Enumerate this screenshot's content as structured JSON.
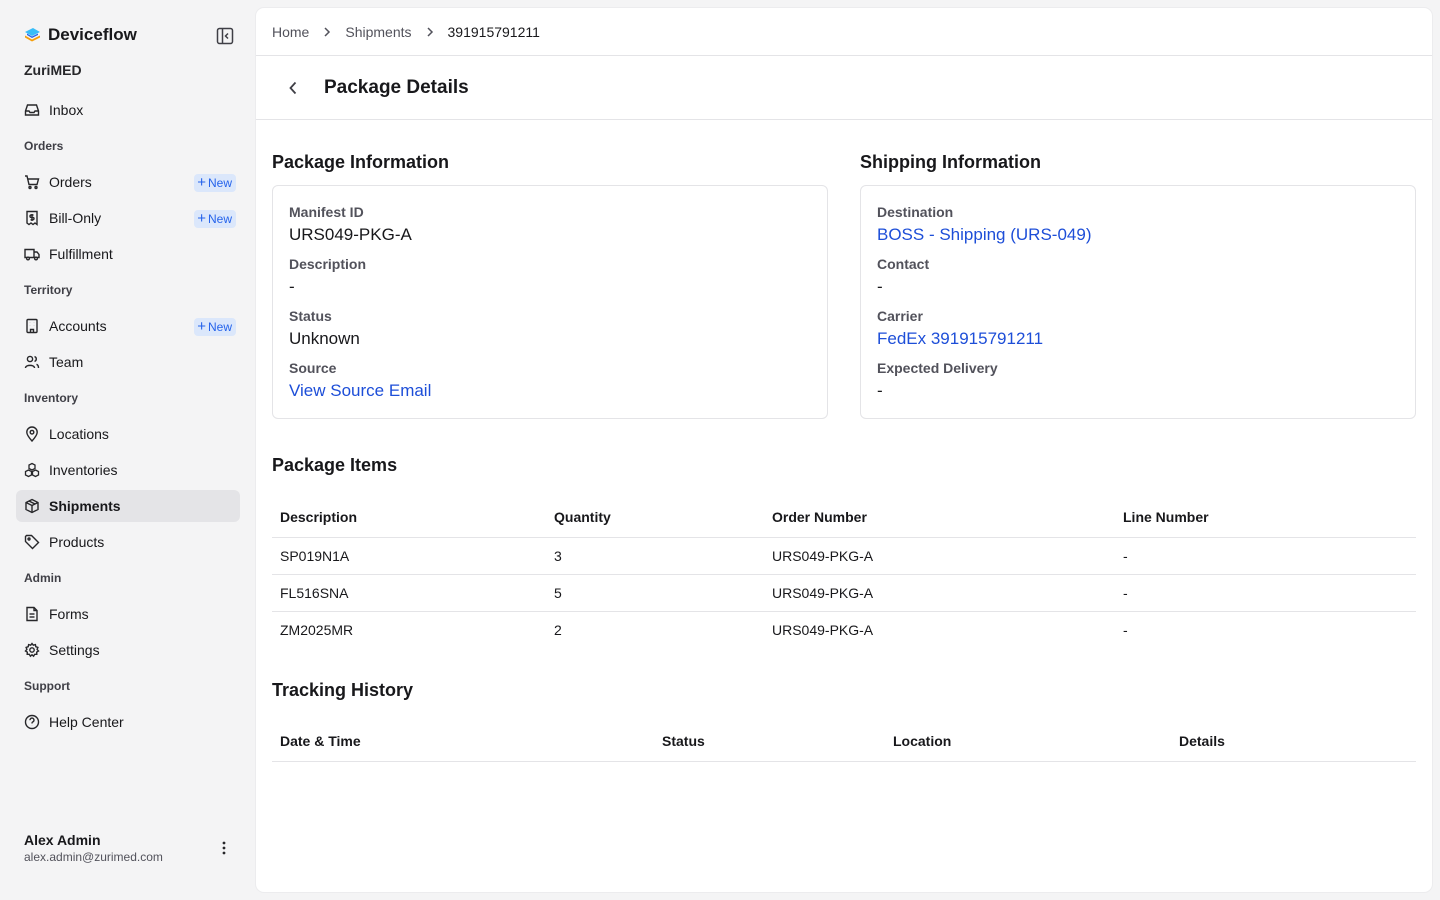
{
  "brand": {
    "name": "Deviceflow",
    "org": "ZuriMED"
  },
  "nav": {
    "inbox": "Inbox",
    "section_orders": "Orders",
    "orders": "Orders",
    "bill_only": "Bill-Only",
    "fulfillment": "Fulfillment",
    "section_territory": "Territory",
    "accounts": "Accounts",
    "team": "Team",
    "section_inventory": "Inventory",
    "locations": "Locations",
    "inventories": "Inventories",
    "shipments": "Shipments",
    "products": "Products",
    "section_admin": "Admin",
    "forms": "Forms",
    "settings": "Settings",
    "section_support": "Support",
    "help_center": "Help Center",
    "new_badge": "New"
  },
  "user": {
    "name": "Alex Admin",
    "email": "alex.admin@zurimed.com"
  },
  "breadcrumb": {
    "home": "Home",
    "shipments": "Shipments",
    "current": "391915791211"
  },
  "page": {
    "title": "Package Details"
  },
  "package_info": {
    "title": "Package Information",
    "manifest_label": "Manifest ID",
    "manifest_value": "URS049-PKG-A",
    "description_label": "Description",
    "description_value": "-",
    "status_label": "Status",
    "status_value": "Unknown",
    "source_label": "Source",
    "source_value": "View Source Email"
  },
  "shipping_info": {
    "title": "Shipping Information",
    "destination_label": "Destination",
    "destination_value": "BOSS - Shipping (URS-049)",
    "contact_label": "Contact",
    "contact_value": "-",
    "carrier_label": "Carrier",
    "carrier_value": "FedEx 391915791211",
    "delivery_label": "Expected Delivery",
    "delivery_value": "-"
  },
  "package_items": {
    "title": "Package Items",
    "columns": [
      "Description",
      "Quantity",
      "Order Number",
      "Line Number"
    ],
    "rows": [
      [
        "SP019N1A",
        "3",
        "URS049-PKG-A",
        "-"
      ],
      [
        "FL516SNA",
        "5",
        "URS049-PKG-A",
        "-"
      ],
      [
        "ZM2025MR",
        "2",
        "URS049-PKG-A",
        "-"
      ]
    ]
  },
  "tracking": {
    "title": "Tracking History",
    "columns": [
      "Date & Time",
      "Status",
      "Location",
      "Details"
    ]
  },
  "colors": {
    "link": "#1d4ed8",
    "badge_bg": "#dbe7fb",
    "badge_text": "#2563eb",
    "active_bg": "#e4e4e7"
  }
}
